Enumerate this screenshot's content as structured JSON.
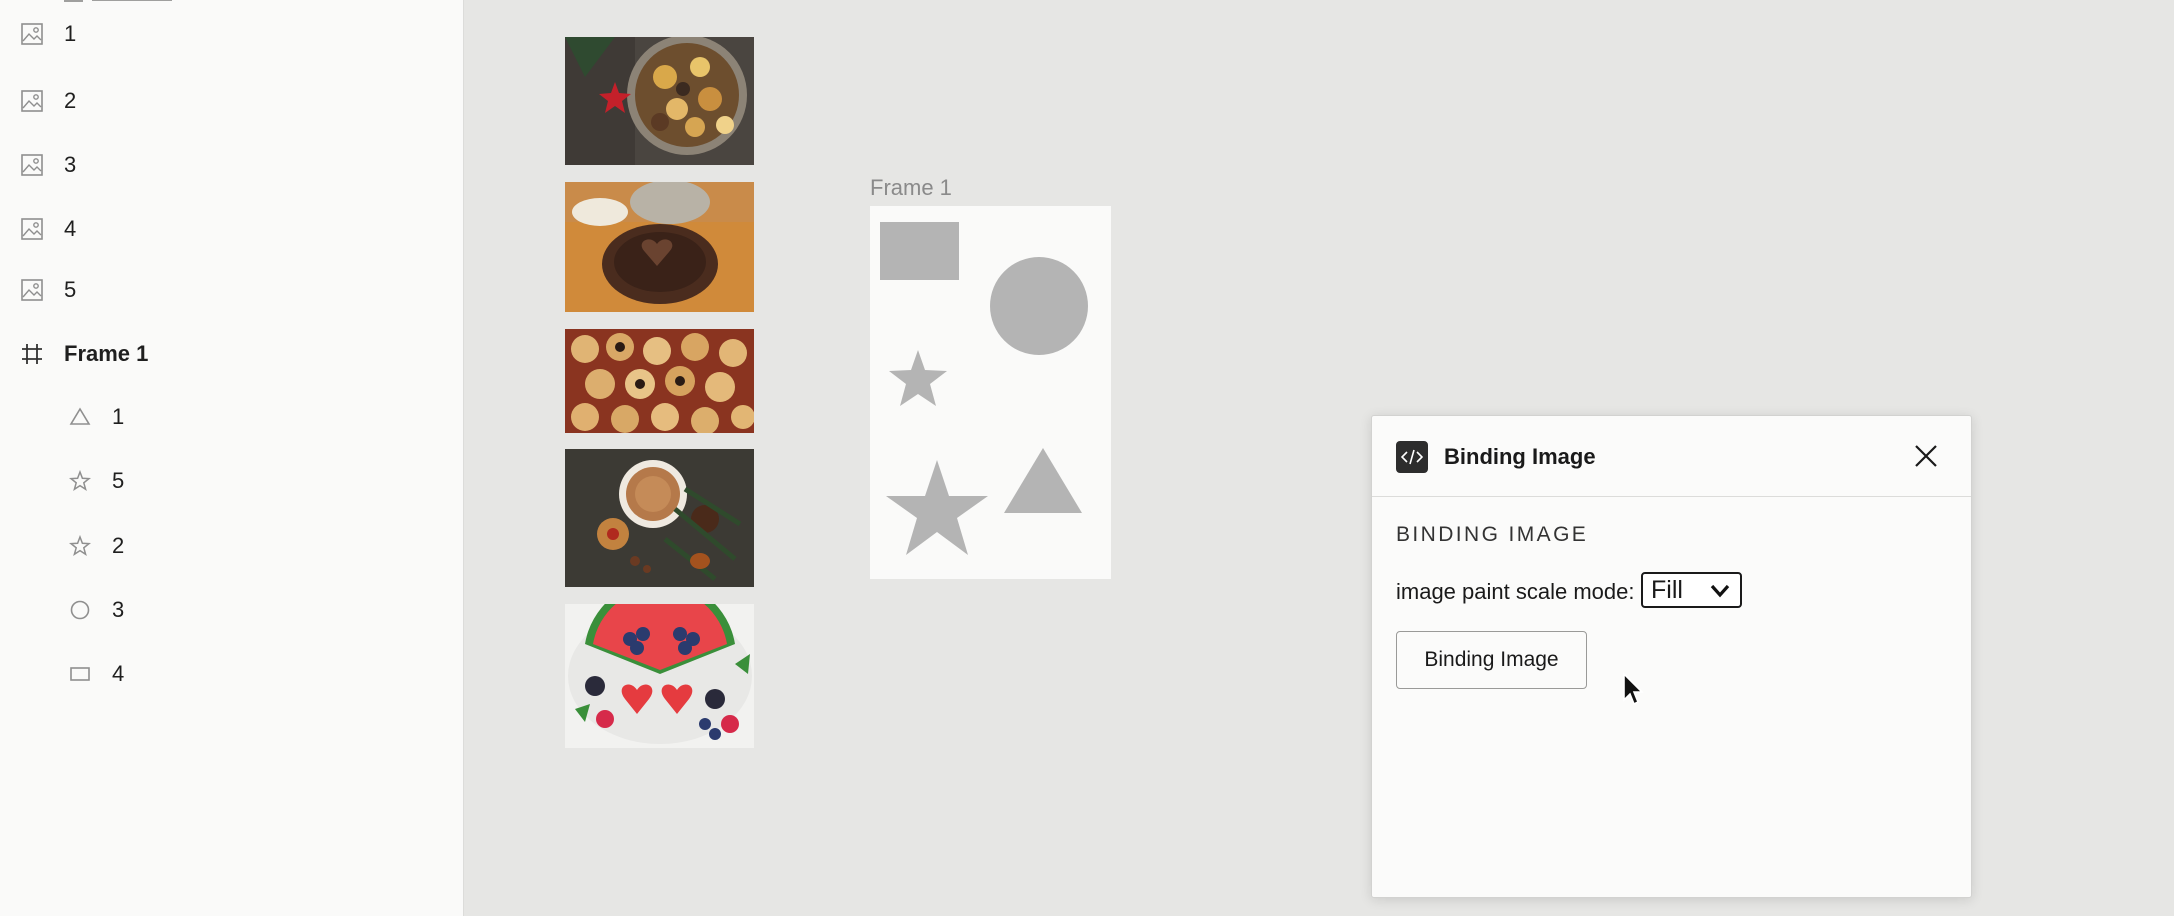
{
  "layers": {
    "top_items": [
      {
        "label": "1",
        "icon": "image-icon"
      },
      {
        "label": "2",
        "icon": "image-icon"
      },
      {
        "label": "3",
        "icon": "image-icon"
      },
      {
        "label": "4",
        "icon": "image-icon"
      },
      {
        "label": "5",
        "icon": "image-icon"
      }
    ],
    "frame": {
      "label": "Frame 1",
      "icon": "frame-icon"
    },
    "children": [
      {
        "label": "1",
        "icon": "triangle-icon"
      },
      {
        "label": "5",
        "icon": "star-icon"
      },
      {
        "label": "2",
        "icon": "star-icon"
      },
      {
        "label": "3",
        "icon": "ellipse-icon"
      },
      {
        "label": "4",
        "icon": "rectangle-icon"
      }
    ]
  },
  "canvas": {
    "frame_label": "Frame 1",
    "images": [
      "cookie-bowl-photo",
      "chocolate-cake-photo",
      "cookies-tray-photo",
      "hot-cocoa-photo",
      "watermelon-berries-photo"
    ],
    "shape_fill": "#b4b4b4"
  },
  "plugin": {
    "title": "Binding Image",
    "section_heading": "BINDING IMAGE",
    "scale_mode_label": "image paint scale mode:",
    "scale_mode_value": "Fill",
    "bind_button_label": "Binding Image"
  }
}
